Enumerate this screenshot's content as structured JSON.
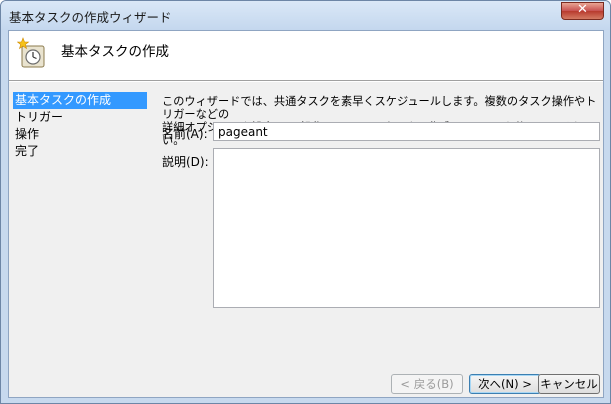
{
  "window": {
    "title": "基本タスクの作成ウィザード"
  },
  "header": {
    "title": "基本タスクの作成",
    "icon": "task-clock-icon"
  },
  "steps": [
    {
      "label": "基本タスクの作成",
      "active": true
    },
    {
      "label": "トリガー",
      "active": false
    },
    {
      "label": "操作",
      "active": false
    },
    {
      "label": "完了",
      "active": false
    }
  ],
  "description": {
    "line1": "このウィザードでは、共通タスクを素早くスケジュールします。複数のタスク操作やトリガーなどの",
    "line2": "詳細オプションや設定は、[操作] ペインの [タスクの作成] コマンドを使ってください。"
  },
  "form": {
    "name_label": "名前(A):",
    "name_value": "pageant",
    "description_label": "説明(D):",
    "description_value": ""
  },
  "buttons": {
    "back": "< 戻る(B)",
    "next": "次へ(N) >",
    "cancel": "キャンセル"
  },
  "colors": {
    "selection": "#3399ff",
    "frame": "#c7d9ee",
    "close": "#c75050"
  }
}
